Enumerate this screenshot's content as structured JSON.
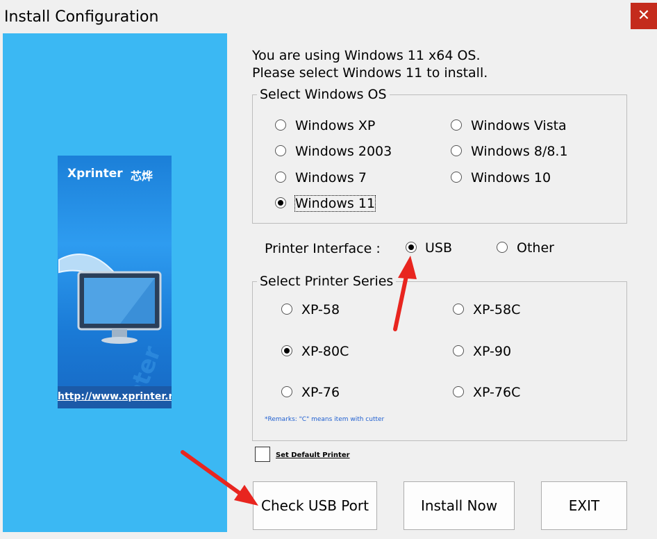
{
  "window": {
    "title": "Install Configuration",
    "close_icon": "close-icon",
    "close_glyph": "✕"
  },
  "banner": {
    "brand": "Xprinter",
    "brand_cn": "芯烨",
    "url": "http://www.xprinter.net"
  },
  "info": {
    "line1": "You are using Windows 11 x64 OS.",
    "line2": "Please select Windows 11 to install."
  },
  "os_group": {
    "legend": "Select Windows OS",
    "options": [
      {
        "label": "Windows XP",
        "checked": false
      },
      {
        "label": "Windows Vista",
        "checked": false
      },
      {
        "label": "Windows 2003",
        "checked": false
      },
      {
        "label": "Windows 8/8.1",
        "checked": false
      },
      {
        "label": "Windows 7",
        "checked": false
      },
      {
        "label": "Windows 10",
        "checked": false
      },
      {
        "label": "Windows 11",
        "checked": true
      }
    ]
  },
  "interface": {
    "label": "Printer Interface :",
    "options": [
      {
        "label": "USB",
        "checked": true
      },
      {
        "label": "Other",
        "checked": false
      }
    ]
  },
  "series_group": {
    "legend": "Select Printer Series",
    "options": [
      {
        "label": "XP-58",
        "checked": false
      },
      {
        "label": "XP-58C",
        "checked": false
      },
      {
        "label": "XP-80C",
        "checked": true
      },
      {
        "label": "XP-90",
        "checked": false
      },
      {
        "label": "XP-76",
        "checked": false
      },
      {
        "label": "XP-76C",
        "checked": false
      }
    ],
    "remark": "*Remarks: \"C\" means item with cutter"
  },
  "default_printer": {
    "label": "Set Default Printer",
    "checked": false
  },
  "buttons": {
    "check": "Check USB Port",
    "install": "Install Now",
    "exit": "EXIT"
  },
  "annotation_color": "#e8251f"
}
